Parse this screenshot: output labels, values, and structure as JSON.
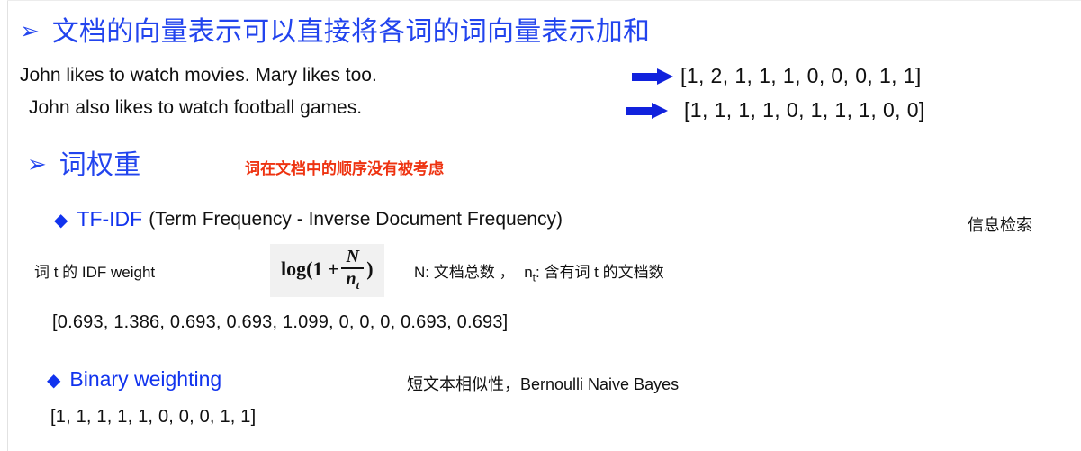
{
  "slide": {
    "headings": [
      {
        "bullet": "➢",
        "text": "文档的向量表示可以直接将各词的词向量表示加和"
      },
      {
        "bullet": "➢",
        "text": "词权重"
      }
    ],
    "sentences": [
      "John likes to watch movies. Mary likes too.",
      "John also likes to watch football games."
    ],
    "vectors": [
      "[1, 2, 1, 1, 1, 0, 0, 0, 1, 1]",
      "[1, 1, 1, 1, 0, 1, 1, 1, 0, 0]"
    ],
    "red_note": "词在文档中的顺序没有被考虑",
    "tfidf": {
      "bullet": "◆",
      "title": "TF-IDF",
      "expansion": "(Term Frequency - Inverse Document Frequency)",
      "side_note": "信息检索",
      "weight_label": "词 t 的 IDF weight",
      "formula": {
        "prefix": "log(1 +",
        "numerator": "N",
        "denominator": "n",
        "denominator_sub": "t",
        "suffix": ")"
      },
      "symbol_desc_n": "N: 文档总数 ，",
      "symbol_desc_nt_base": "n",
      "symbol_desc_nt_sub": "t",
      "symbol_desc_nt_rest": ": 含有词 t 的文档数",
      "vector": "[0.693, 1.386, 0.693, 0.693, 1.099, 0, 0, 0, 0.693, 0.693]"
    },
    "binary": {
      "bullet": "◆",
      "title": "Binary weighting",
      "side_note": "短文本相似性，Bernoulli Naive Bayes",
      "vector": "[1, 1, 1, 1, 1, 0, 0, 0, 1, 1]"
    }
  },
  "colors": {
    "heading_blue": "#2244ee",
    "accent_blue": "#1133ee",
    "arrow_blue": "#1122dd",
    "red": "#ee3311",
    "formula_bg": "#f1f1f1"
  }
}
